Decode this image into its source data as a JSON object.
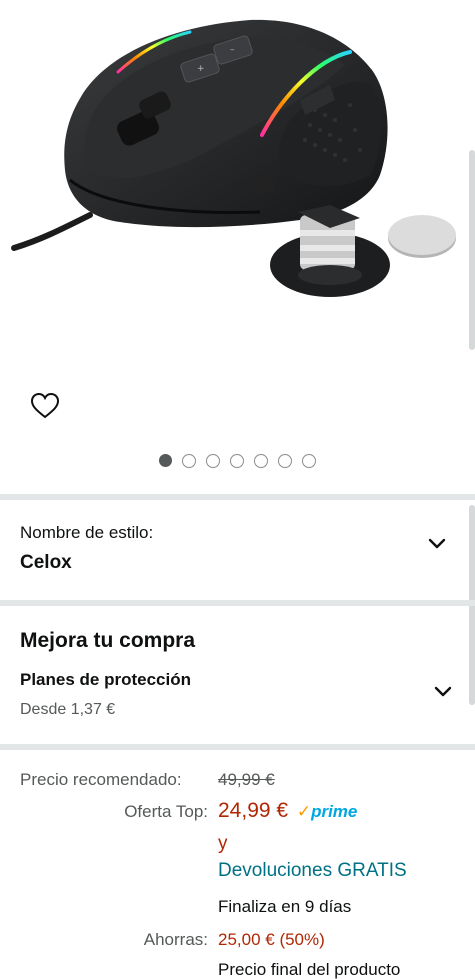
{
  "gallery": {
    "dots_total": 7,
    "active_dot": 0
  },
  "style": {
    "label": "Nombre de estilo:",
    "value": "Celox"
  },
  "upgrade": {
    "title": "Mejora tu compra",
    "plan_title": "Planes de protección",
    "plan_price": "Desde 1,37 €"
  },
  "pricing": {
    "list_label": "Precio recomendado:",
    "list_price": "49,99 €",
    "deal_label": "Oferta Top:",
    "deal_price": "24,99 €",
    "prime_check": "✓",
    "prime_word": "prime",
    "and_text": "y",
    "returns_text": "Devoluciones GRATIS",
    "ends_text": "Finaliza en 9 días",
    "savings_label": "Ahorras:",
    "savings_value": "25,00 € (50%)",
    "final_text": "Precio final del producto"
  },
  "colors": {
    "price_red": "#b12704",
    "link_teal": "#007185",
    "prime_blue": "#00a8e1",
    "prime_orange": "#ff9900",
    "divider": "#e3e6e6"
  },
  "icons": [
    "heart-outline-icon",
    "chevron-down-icon",
    "prime-check-icon"
  ]
}
